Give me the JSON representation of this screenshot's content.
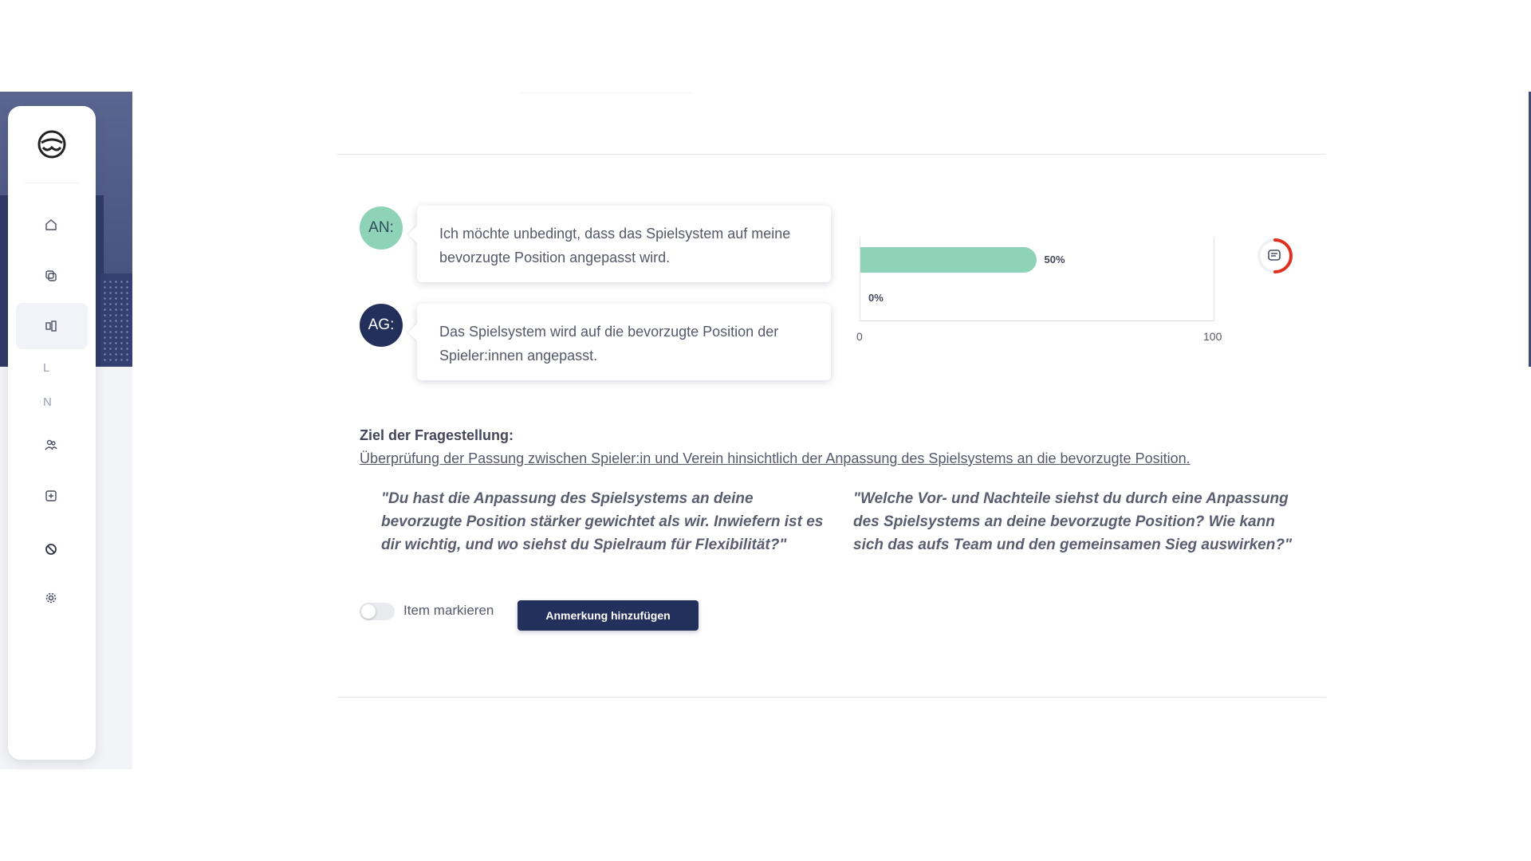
{
  "sidebar": {
    "items": [
      {
        "icon": "home-icon"
      },
      {
        "icon": "copy-icon"
      },
      {
        "icon": "compare-icon",
        "active": true
      },
      {
        "letter": "L"
      },
      {
        "letter": "N"
      },
      {
        "icon": "users-icon"
      },
      {
        "icon": "add-box-icon"
      },
      {
        "icon": "block-icon"
      },
      {
        "icon": "settings-icon"
      }
    ]
  },
  "dialog": {
    "an_label": "AN:",
    "an_text": "Ich möchte unbedingt, dass das Spielsystem auf meine bevorzugte Position angepasst wird.",
    "ag_label": "AG:",
    "ag_text": "Das Spielsystem wird auf die bevorzugte Position der Spieler:innen angepasst."
  },
  "chart_data": {
    "type": "bar",
    "orientation": "horizontal",
    "categories": [
      "AN",
      "AG"
    ],
    "values": [
      50,
      0
    ],
    "value_labels": [
      "50%",
      "0%"
    ],
    "xlim": [
      0,
      100
    ],
    "tick_labels": [
      "0",
      "100"
    ],
    "colors": {
      "bar": "#8ed3b8"
    }
  },
  "goal": {
    "title": "Ziel der Fragestellung:",
    "text": "Überprüfung der Passung zwischen Spieler:in und Verein hinsichtlich der Anpassung des Spielsystems an die bevorzugte Position."
  },
  "quotes": {
    "left": "\"Du hast die Anpassung des Spielsystems an deine bevorzugte Position stärker gewichtet als wir. Inwiefern ist es dir wichtig, und wo siehst du Spielraum für Flexibilität?\"",
    "right": "\"Welche Vor- und Nachteile siehst du durch eine Anpassung des Spielsystems an deine bevorzugte Position? Wie kann sich das aufs Team und den gemeinsamen Sieg auswirken?\""
  },
  "actions": {
    "toggle_label": "Item markieren",
    "toggle_on": false,
    "button_label": "Anmerkung hinzufügen"
  },
  "colors": {
    "accent": "#8ed3b8",
    "primary": "#24305c",
    "ring": "#e0301e"
  }
}
